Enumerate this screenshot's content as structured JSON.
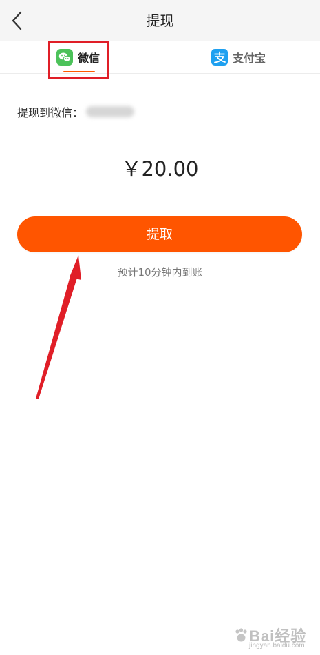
{
  "header": {
    "title": "提现",
    "back_icon": "chevron-left-icon"
  },
  "tabs": [
    {
      "label": "微信",
      "icon": "wechat-icon",
      "icon_color": "#4cc25a",
      "selected": true
    },
    {
      "label": "支付宝",
      "icon": "alipay-icon",
      "icon_color": "#1ea0f0",
      "selected": false
    }
  ],
  "withdraw": {
    "target_label": "提现到微信：",
    "amount": "￥20.00",
    "button_label": "提取",
    "hint": "预计10分钟内到账"
  },
  "colors": {
    "accent": "#ff5500",
    "annotation": "#e01e27"
  },
  "watermark": {
    "text": "Bai经验",
    "sub": "jingyan.baidu.com"
  }
}
